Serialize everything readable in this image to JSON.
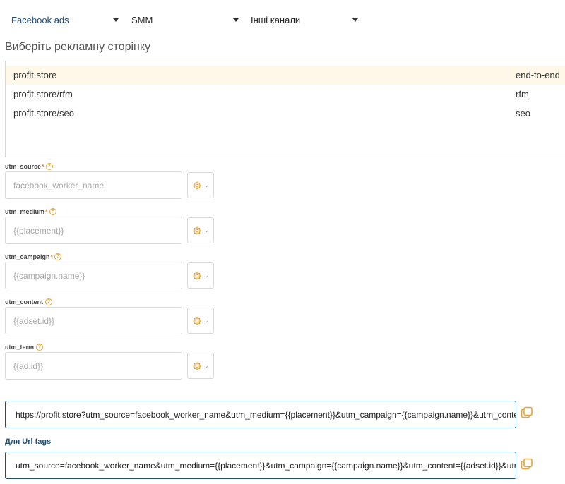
{
  "channels": [
    {
      "label": "Facebook ads"
    },
    {
      "label": "SMM"
    },
    {
      "label": "Інші канали"
    }
  ],
  "pages_heading": "Виберіть рекламну сторінку",
  "pages": [
    {
      "url": "profit.store",
      "tag": "end-to-end",
      "selected": true
    },
    {
      "url": "profit.store/rfm",
      "tag": "rfm",
      "selected": false
    },
    {
      "url": "profit.store/seo",
      "tag": "seo",
      "selected": false
    }
  ],
  "fields": [
    {
      "label": "utm_source",
      "required": "*",
      "value": "facebook_worker_name"
    },
    {
      "label": "utm_medium",
      "required": "*",
      "value": "{{placement}}"
    },
    {
      "label": "utm_campaign",
      "required": "*",
      "value": "{{campaign.name}}"
    },
    {
      "label": "utm_content",
      "required": "",
      "value": "{{adset.id}}"
    },
    {
      "label": "utm_term",
      "required": "",
      "value": "{{ad.id}}"
    }
  ],
  "help_glyph": "?",
  "chevron_glyph": "⌄",
  "full_url": "https://profit.store?utm_source=facebook_worker_name&utm_medium={{placement}}&utm_campaign={{campaign.name}}&utm_content={{adset.id}}&utm_term={{ad.id}}",
  "url_tags_label": "Для Url tags",
  "url_tags": "utm_source=facebook_worker_name&utm_medium={{placement}}&utm_campaign={{campaign.name}}&utm_content={{adset.id}}&utm_term={{ad.id}}",
  "colors": {
    "accent": "#1f4d7a",
    "icon": "#e3a53c",
    "selected_row": "#fff7e8"
  }
}
